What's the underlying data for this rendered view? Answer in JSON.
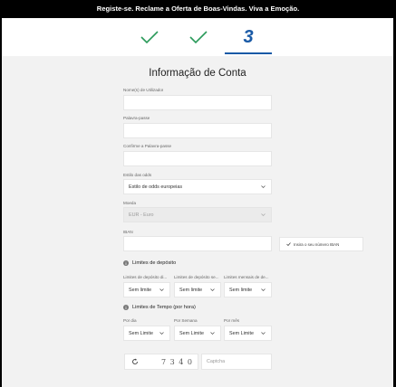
{
  "banner": {
    "text": "Registe-se. Reclame a Oferta de Boas-Vindas. Viva a Emoção."
  },
  "steps": {
    "current": "3",
    "accent": "#1a5aa6",
    "check_color": "#2a9a5a"
  },
  "form": {
    "title": "Informação de Conta",
    "username": {
      "label": "Nome(s) de Utilizador",
      "value": ""
    },
    "password": {
      "label": "Palavra-passe",
      "value": ""
    },
    "confirm_password": {
      "label": "Confirme a Palavra-passe",
      "value": ""
    },
    "odds_style": {
      "label": "Estilo das odds",
      "value": "Estilo de odds europeias"
    },
    "currency": {
      "label": "Moeda",
      "value": "EUR - Euro"
    },
    "iban": {
      "label": "IBAN",
      "value": "",
      "tip": "Insira o seu número IBAN"
    }
  },
  "deposit_limits": {
    "heading": "Limites de depósito",
    "fields": [
      {
        "label": "Limites de depósito di...",
        "value": "Sem limite"
      },
      {
        "label": "Limites de depósito se...",
        "value": "Sem limite"
      },
      {
        "label": "Limites mensais de de...",
        "value": "Sem limite"
      }
    ]
  },
  "time_limits": {
    "heading": "Limites de Tempo (por hora)",
    "fields": [
      {
        "label": "Por dia",
        "value": "Sem Limite"
      },
      {
        "label": "Por Semana",
        "value": "Sem Limite"
      },
      {
        "label": "Por mês",
        "value": "Sem Limite"
      }
    ]
  },
  "captcha": {
    "code": "7 3 4 0",
    "placeholder": "Captcha"
  }
}
